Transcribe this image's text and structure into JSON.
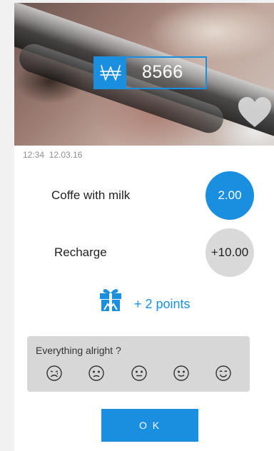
{
  "header": {
    "currency_symbol": "₩",
    "balance": "8566"
  },
  "timestamp": {
    "time": "12:34",
    "date": "12.03.16"
  },
  "items": [
    {
      "label": "Coffe with milk",
      "amount": "2.00"
    },
    {
      "label": "Recharge",
      "amount": "+10.00"
    }
  ],
  "points": {
    "text": "+ 2 points",
    "icon": "gift-icon"
  },
  "feedback": {
    "question": "Everything alright ?",
    "options": [
      "very-unhappy-face-icon",
      "sad-face-icon",
      "neutral-face-icon",
      "smile-face-icon",
      "happy-face-icon"
    ]
  },
  "actions": {
    "ok_label": "O K"
  },
  "colors": {
    "accent": "#1a8fe0",
    "grey_circle": "#d9d9d9",
    "feedback_bg": "#d7d7d7"
  }
}
